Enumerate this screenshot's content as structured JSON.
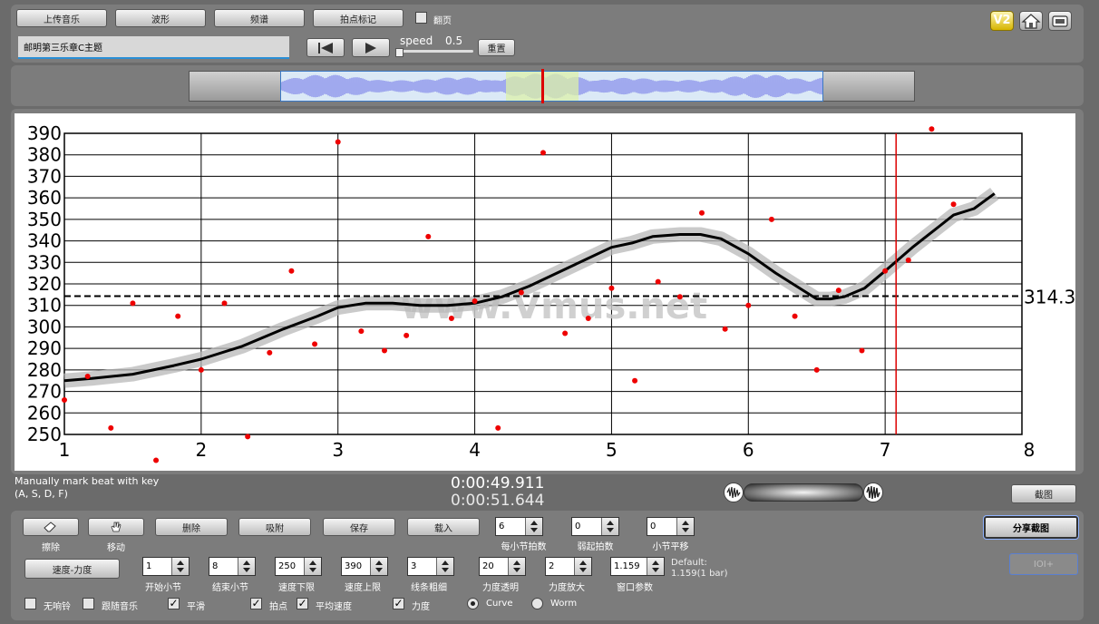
{
  "toolbar": {
    "upload_music": "上传音乐",
    "waveform": "波形",
    "spectrum": "频谱",
    "beat_marking": "拍点标记",
    "flip_page": "翻页",
    "speed_label": "speed",
    "speed_value": "0.5",
    "reset": "重置",
    "v2_badge": "V2"
  },
  "track": {
    "title": "邮明第三乐章C主题"
  },
  "chart_data": {
    "type": "line",
    "x_ticks": [
      1,
      2,
      3,
      4,
      5,
      6,
      7,
      8
    ],
    "y_ticks": [
      250,
      260,
      270,
      280,
      290,
      300,
      310,
      320,
      330,
      340,
      350,
      360,
      370,
      380,
      390
    ],
    "xlim": [
      1,
      8
    ],
    "ylim": [
      250,
      390
    ],
    "grid": true,
    "mean_line": {
      "value": 314.3,
      "label": "314.3"
    },
    "cursor_x": 7.08,
    "watermark": "www.Vmus.net",
    "curve": {
      "x": [
        1.0,
        1.2,
        1.5,
        1.8,
        2.0,
        2.3,
        2.6,
        2.85,
        3.0,
        3.2,
        3.4,
        3.6,
        3.8,
        4.0,
        4.2,
        4.4,
        4.6,
        4.8,
        5.0,
        5.15,
        5.3,
        5.5,
        5.65,
        5.8,
        6.0,
        6.2,
        6.4,
        6.5,
        6.6,
        6.7,
        6.85,
        7.0,
        7.2,
        7.4,
        7.5,
        7.65,
        7.8
      ],
      "y": [
        275,
        276,
        278,
        282,
        285,
        291,
        299,
        305,
        309,
        311,
        311,
        310,
        310,
        311,
        314,
        319,
        325,
        331,
        337,
        339,
        342,
        343,
        343,
        341,
        334,
        325,
        317,
        313,
        313,
        314,
        318,
        326,
        337,
        347,
        352,
        355,
        362
      ]
    },
    "points": {
      "x": [
        1.0,
        1.17,
        1.34,
        1.5,
        1.67,
        1.83,
        2.0,
        2.17,
        2.34,
        2.5,
        2.66,
        2.83,
        3.0,
        3.17,
        3.34,
        3.5,
        3.66,
        3.83,
        4.0,
        4.17,
        4.34,
        4.5,
        4.66,
        4.83,
        5.0,
        5.17,
        5.34,
        5.5,
        5.66,
        5.83,
        6.0,
        6.17,
        6.34,
        6.5,
        6.66,
        6.83,
        7.0,
        7.17,
        7.34,
        7.5
      ],
      "y": [
        266,
        277,
        253,
        311,
        238,
        305,
        280,
        311,
        249,
        288,
        326,
        292,
        386,
        298,
        289,
        296,
        342,
        304,
        312,
        253,
        316,
        381,
        297,
        304,
        318,
        275,
        321,
        314,
        353,
        299,
        310,
        350,
        305,
        280,
        317,
        289,
        326,
        331,
        392,
        357
      ]
    }
  },
  "status": {
    "hint_line1": "Manually mark beat with key",
    "hint_line2": "(A, S, D, F)",
    "time_current": "0:00:49.911",
    "time_total": "0:00:51.644",
    "screenshot": "截图"
  },
  "controls": {
    "erase": "擦除",
    "move": "移动",
    "delete": "删除",
    "snap": "吸附",
    "save": "保存",
    "load": "载入",
    "beats_per_bar": {
      "value": "6",
      "label": "每小节拍数"
    },
    "pickup_beats": {
      "value": "0",
      "label": "弱起拍数"
    },
    "bar_offset": {
      "value": "0",
      "label": "小节平移"
    },
    "share_screenshot": "分享截图",
    "ioi_button": "IOI+",
    "tempo_dynamics": "速度-力度",
    "start_bar": {
      "value": "1",
      "label": "开始小节"
    },
    "end_bar": {
      "value": "8",
      "label": "结束小节"
    },
    "tempo_min": {
      "value": "250",
      "label": "速度下限"
    },
    "tempo_max": {
      "value": "390",
      "label": "速度上限"
    },
    "line_width": {
      "value": "3",
      "label": "线条粗细"
    },
    "dynamics_opacity": {
      "value": "20",
      "label": "力度透明"
    },
    "dynamics_zoom": {
      "value": "2",
      "label": "力度放大"
    },
    "window_param": {
      "value": "1.159",
      "label": "窗口参数"
    },
    "default_line1": "Default:",
    "default_line2": "1.159(1 bar)",
    "no_bells": "无响铃",
    "follow_music": "跟随音乐",
    "smooth": "平滑",
    "beat_points": "拍点",
    "avg_tempo": "平均速度",
    "dynamics": "力度",
    "curve": "Curve",
    "worm": "Worm"
  }
}
